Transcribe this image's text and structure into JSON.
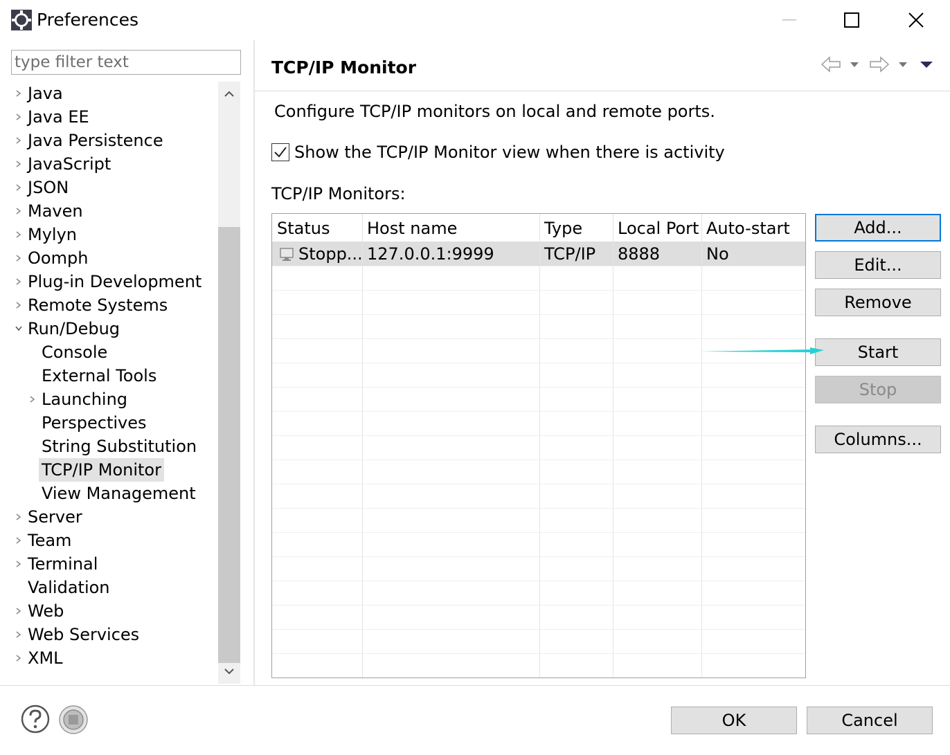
{
  "window": {
    "title": "Preferences",
    "icon": "eclipse-gear-icon"
  },
  "filter": {
    "placeholder": "type filter text",
    "value": ""
  },
  "tree": {
    "items": [
      {
        "label": "Java",
        "expander": "collapsed",
        "level": 0
      },
      {
        "label": "Java EE",
        "expander": "collapsed",
        "level": 0
      },
      {
        "label": "Java Persistence",
        "expander": "collapsed",
        "level": 0
      },
      {
        "label": "JavaScript",
        "expander": "collapsed",
        "level": 0
      },
      {
        "label": "JSON",
        "expander": "collapsed",
        "level": 0
      },
      {
        "label": "Maven",
        "expander": "collapsed",
        "level": 0
      },
      {
        "label": "Mylyn",
        "expander": "collapsed",
        "level": 0
      },
      {
        "label": "Oomph",
        "expander": "collapsed",
        "level": 0
      },
      {
        "label": "Plug-in Development",
        "expander": "collapsed",
        "level": 0
      },
      {
        "label": "Remote Systems",
        "expander": "collapsed",
        "level": 0
      },
      {
        "label": "Run/Debug",
        "expander": "expanded",
        "level": 0
      },
      {
        "label": "Console",
        "expander": "none",
        "level": 1
      },
      {
        "label": "External Tools",
        "expander": "none",
        "level": 1
      },
      {
        "label": "Launching",
        "expander": "collapsed",
        "level": 1
      },
      {
        "label": "Perspectives",
        "expander": "none",
        "level": 1
      },
      {
        "label": "String Substitution",
        "expander": "none",
        "level": 1
      },
      {
        "label": "TCP/IP Monitor",
        "expander": "none",
        "level": 1,
        "selected": true
      },
      {
        "label": "View Management",
        "expander": "none",
        "level": 1
      },
      {
        "label": "Server",
        "expander": "collapsed",
        "level": 0
      },
      {
        "label": "Team",
        "expander": "collapsed",
        "level": 0
      },
      {
        "label": "Terminal",
        "expander": "collapsed",
        "level": 0
      },
      {
        "label": "Validation",
        "expander": "none",
        "level": 0
      },
      {
        "label": "Web",
        "expander": "collapsed",
        "level": 0
      },
      {
        "label": "Web Services",
        "expander": "collapsed",
        "level": 0
      },
      {
        "label": "XML",
        "expander": "collapsed",
        "level": 0
      }
    ]
  },
  "page": {
    "title": "TCP/IP Monitor",
    "description": "Configure TCP/IP monitors on local and remote ports.",
    "show_view_checkbox": {
      "label": "Show the TCP/IP Monitor view when there is activity",
      "checked": true
    },
    "monitors_label": "TCP/IP Monitors:"
  },
  "table": {
    "columns": [
      "Status",
      "Host name",
      "Type",
      "Local Port",
      "Auto-start"
    ],
    "rows": [
      {
        "status": "Stopp...",
        "host": "127.0.0.1:9999",
        "type": "TCP/IP",
        "local_port": "8888",
        "auto_start": "No",
        "selected": true
      }
    ]
  },
  "buttons": {
    "add": "Add...",
    "edit": "Edit...",
    "remove": "Remove",
    "start": "Start",
    "stop": "Stop",
    "columns": "Columns..."
  },
  "footer": {
    "ok": "OK",
    "cancel": "Cancel"
  },
  "colors": {
    "annotation_arrow": "#26d0d6",
    "default_button_border": "#0078d7",
    "selection": "#e2e2e2"
  }
}
